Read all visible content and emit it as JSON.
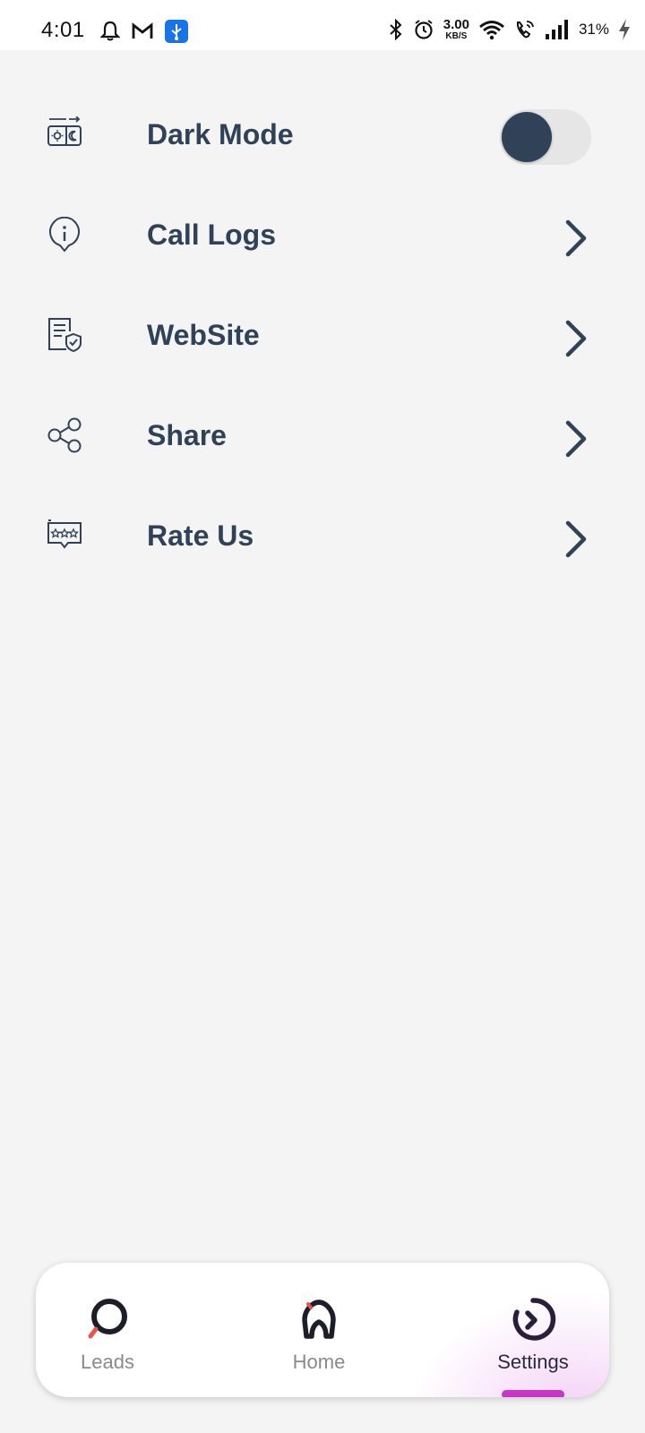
{
  "status_bar": {
    "time": "4:01",
    "speed_value": "3.00",
    "speed_unit": "KB/S",
    "battery": "31%"
  },
  "settings": {
    "items": [
      {
        "label": "Dark Mode",
        "icon": "dark-mode-icon",
        "control": "toggle",
        "toggle_on": false
      },
      {
        "label": "Call Logs",
        "icon": "info-icon",
        "control": "chevron"
      },
      {
        "label": "WebSite",
        "icon": "document-shield-icon",
        "control": "chevron"
      },
      {
        "label": "Share",
        "icon": "share-icon",
        "control": "chevron"
      },
      {
        "label": "Rate Us",
        "icon": "rating-stars-icon",
        "control": "chevron"
      }
    ]
  },
  "bottom_nav": {
    "items": [
      {
        "label": "Leads",
        "icon": "search-icon"
      },
      {
        "label": "Home",
        "icon": "home-icon"
      },
      {
        "label": "Settings",
        "icon": "settings-icon",
        "active": true
      }
    ]
  },
  "colors": {
    "text": "#2f4257",
    "accent": "#c935c4",
    "background": "#f4f4f4"
  }
}
